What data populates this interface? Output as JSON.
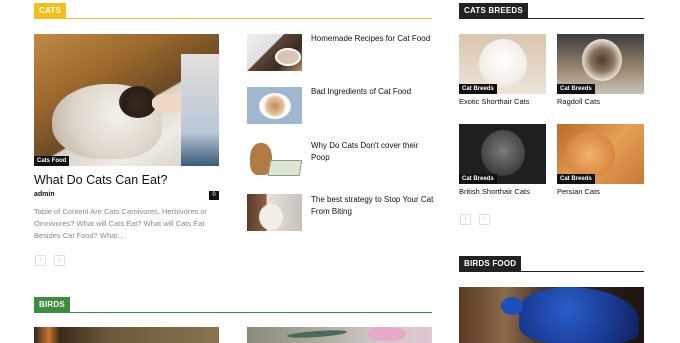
{
  "colors": {
    "cats_accent": "#f5bf1b",
    "birds_accent": "#3d8c40",
    "dark_header": "#222222",
    "badge_bg": "#111111"
  },
  "cats_section": {
    "label": "CATS",
    "main": {
      "badge": "Cats Food",
      "title": "What Do Cats Can Eat?",
      "author": "admin",
      "comments": "0",
      "excerpt": "Table of Content Are Cats Carnivores, Herbivores or Omnivores?  What will Cats Eat?  What will Cats Eat Besides Cat Food?  What..."
    },
    "list": [
      {
        "title": "Homemade Recipes for Cat Food"
      },
      {
        "title": "Bad Ingredients of Cat Food"
      },
      {
        "title": "Why Do Cats Don't cover their Poop"
      },
      {
        "title": "The best strategy to Stop Your Cat From Biting"
      }
    ],
    "pager": {
      "prev": "‹",
      "next": "›"
    }
  },
  "cat_breeds": {
    "label": "CATS BREEDS",
    "items": [
      {
        "badge": "Cat Breeds",
        "title": "Exotic Shorthair Cats"
      },
      {
        "badge": "Cat Breeds",
        "title": "Ragdoll Cats"
      },
      {
        "badge": "Cat Breeds",
        "title": "British Shorthair Cats"
      },
      {
        "badge": "Cat Breeds",
        "title": "Persian Cats"
      }
    ],
    "pager": {
      "prev": "‹",
      "next": "›"
    }
  },
  "birds_section": {
    "label": "BIRDS"
  },
  "birds_food": {
    "label": "BIRDS FOOD"
  }
}
